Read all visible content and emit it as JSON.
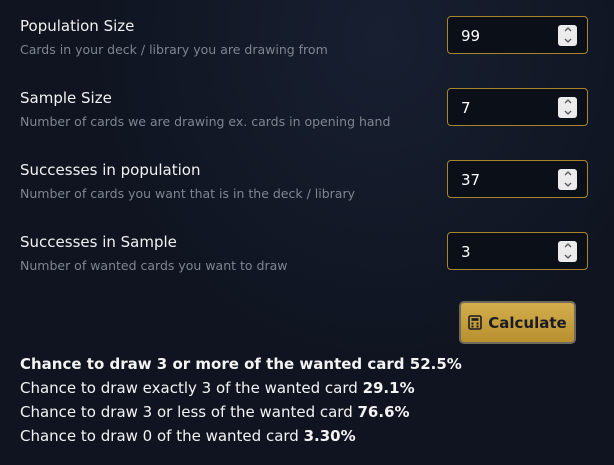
{
  "fields": [
    {
      "label": "Population Size",
      "help": "Cards in your deck / library you are drawing from",
      "value": "99"
    },
    {
      "label": "Sample Size",
      "help": "Number of cards we are drawing ex. cards in opening hand",
      "value": "7"
    },
    {
      "label": "Successes in population",
      "help": "Number of cards you want that is in the deck / library",
      "value": "37"
    },
    {
      "label": "Successes in Sample",
      "help": "Number of wanted cards you want to draw",
      "value": "3"
    }
  ],
  "calculate": {
    "label": "Calculate",
    "icon": "calculator-icon",
    "color": "#c9a23f"
  },
  "results": [
    {
      "text": "Chance to draw 3 or more of the wanted card ",
      "value": "52.5%"
    },
    {
      "text": "Chance to draw exactly 3 of the wanted card ",
      "value": "29.1%"
    },
    {
      "text": "Chance to draw 3 or less of the wanted card ",
      "value": "76.6%"
    },
    {
      "text": "Chance to draw 0 of the wanted card ",
      "value": "3.30%"
    }
  ],
  "colors": {
    "accent": "#a8862e",
    "background": "#0f1420",
    "muted_text": "#7f8591"
  }
}
